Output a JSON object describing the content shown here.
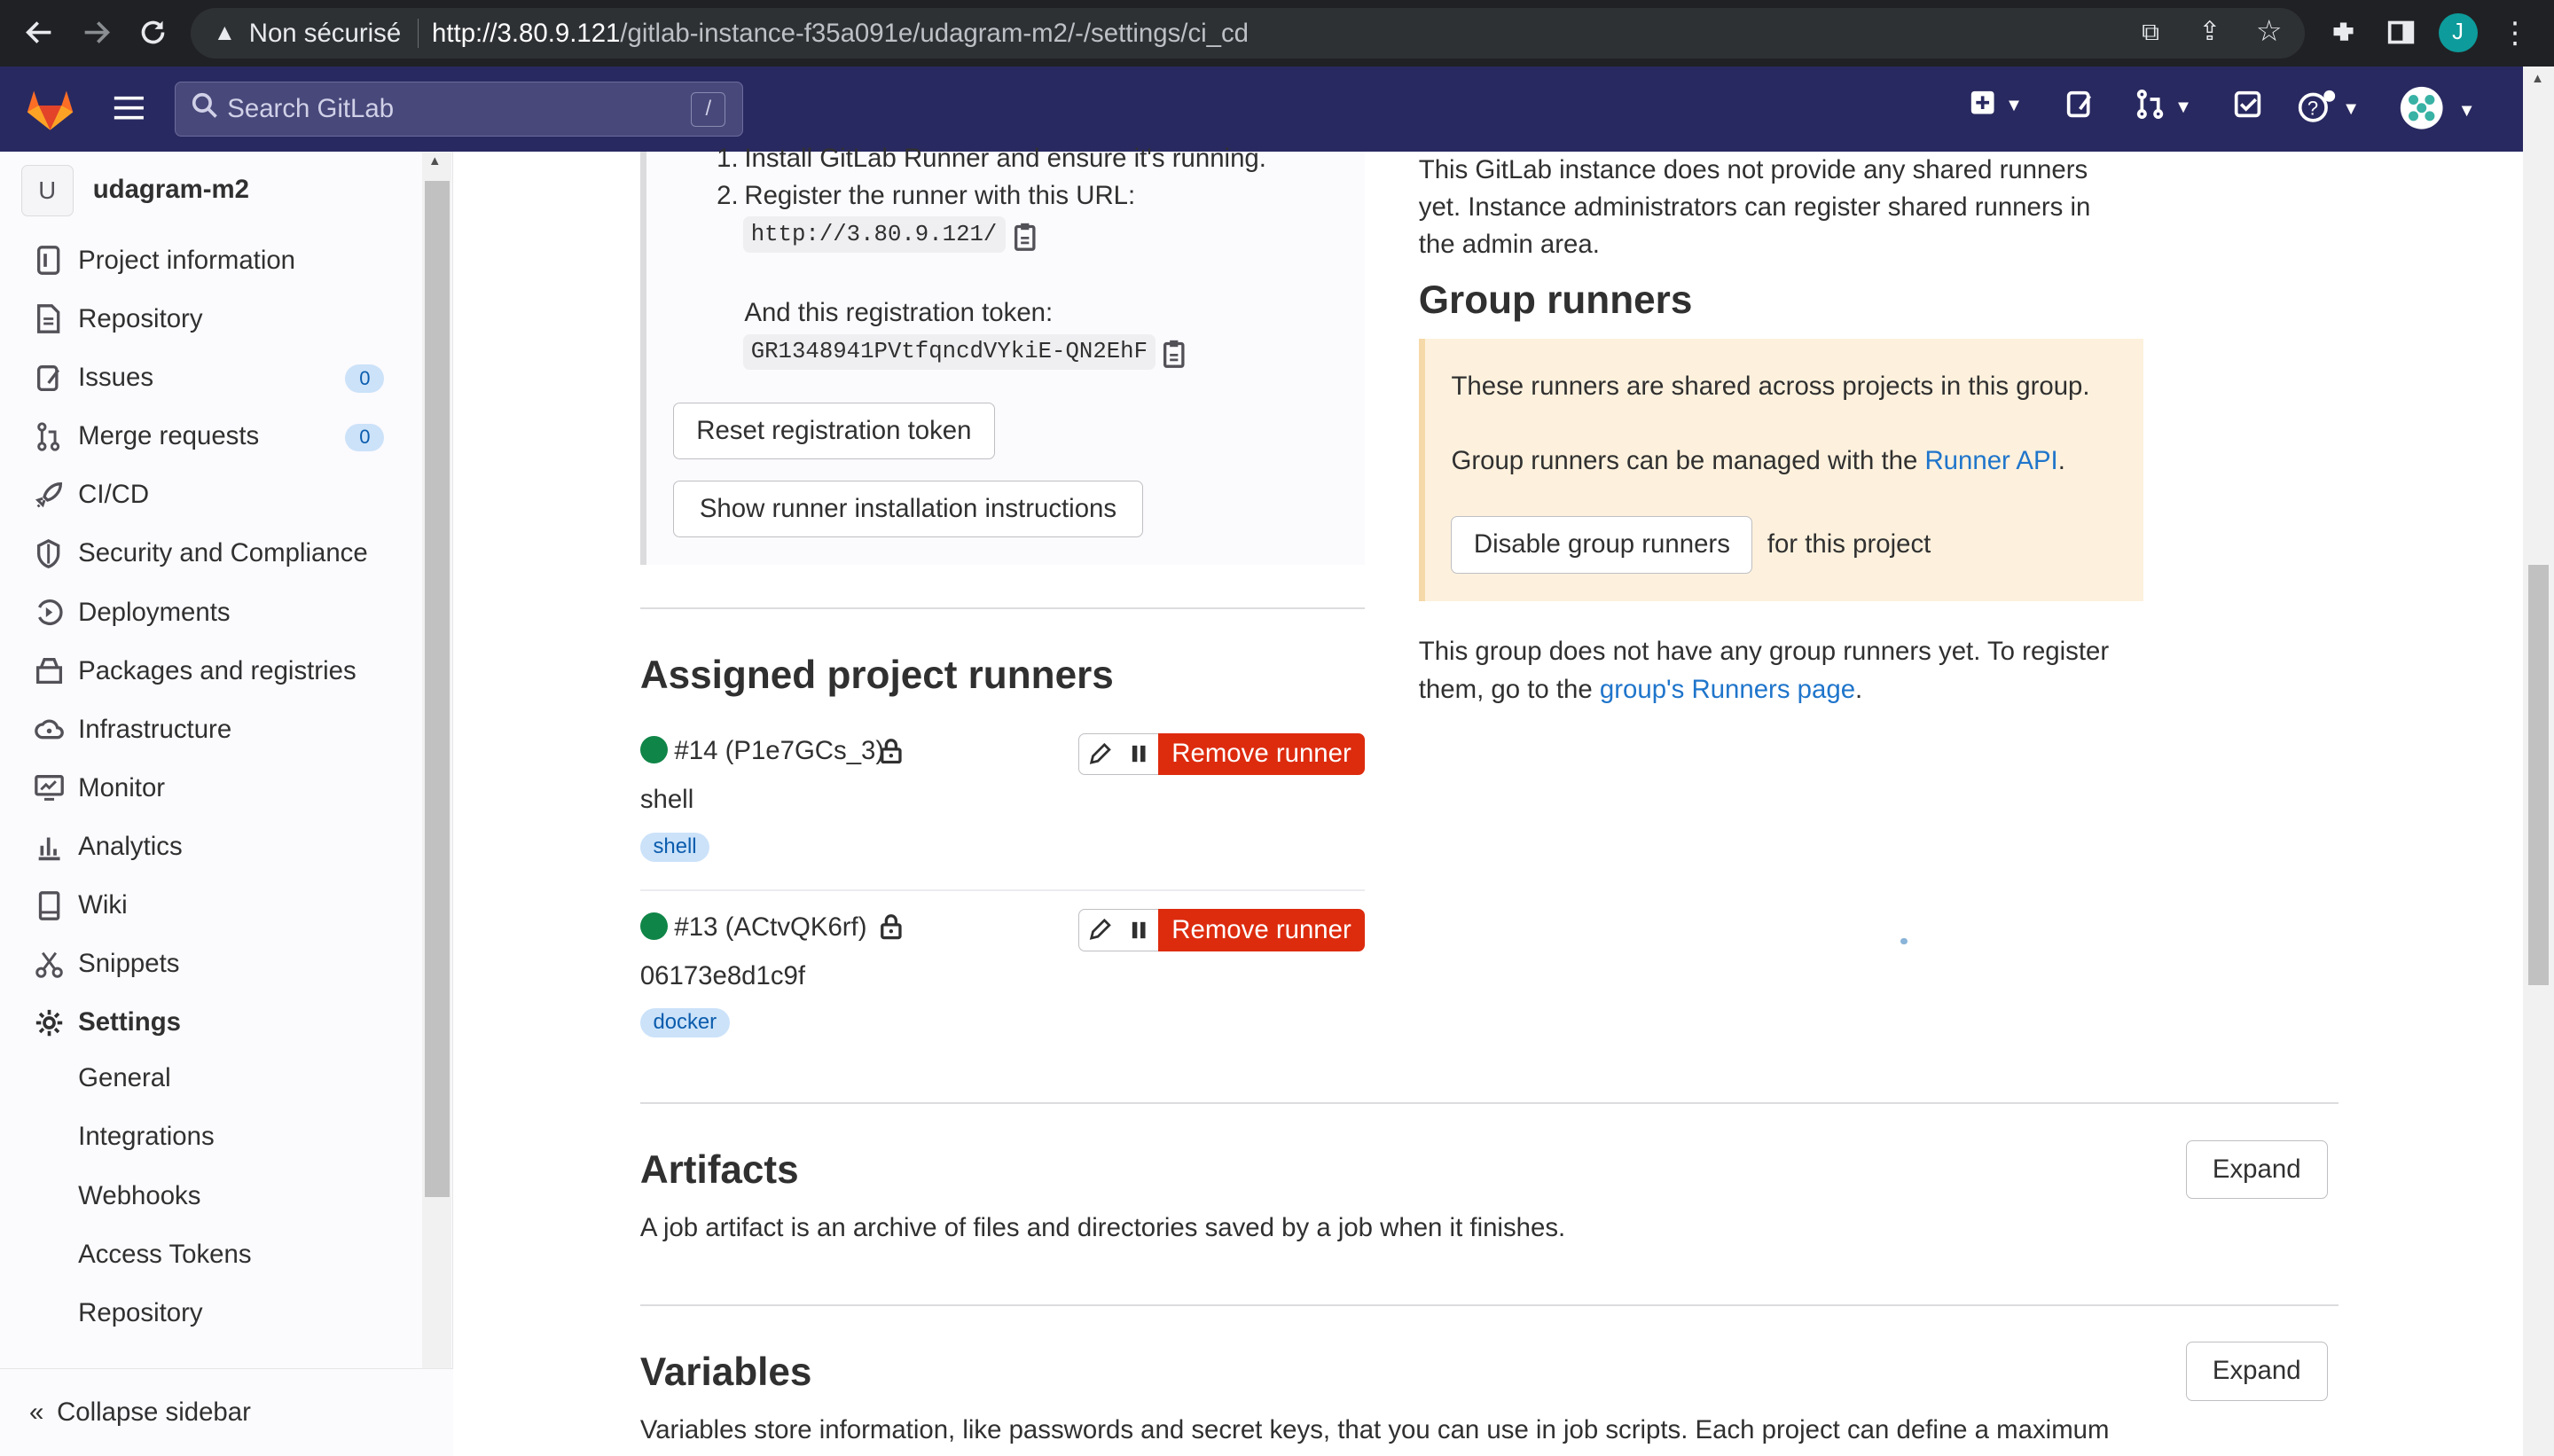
{
  "browser": {
    "security_label": "Non sécurisé",
    "url_host": "http://3.80.9.121",
    "url_path": "/gitlab-instance-f35a091e/udagram-m2/-/settings/ci_cd",
    "avatar_letter": "J"
  },
  "header": {
    "search_placeholder": "Search GitLab",
    "search_shortcut": "/"
  },
  "sidebar": {
    "project_letter": "U",
    "project_name": "udagram-m2",
    "items": [
      {
        "label": "Project information",
        "icon": "info-icon"
      },
      {
        "label": "Repository",
        "icon": "doc-icon"
      },
      {
        "label": "Issues",
        "icon": "issues-icon",
        "count": "0"
      },
      {
        "label": "Merge requests",
        "icon": "merge-icon",
        "count": "0"
      },
      {
        "label": "CI/CD",
        "icon": "rocket-icon"
      },
      {
        "label": "Security and Compliance",
        "icon": "shield-icon"
      },
      {
        "label": "Deployments",
        "icon": "deploy-icon"
      },
      {
        "label": "Packages and registries",
        "icon": "package-icon"
      },
      {
        "label": "Infrastructure",
        "icon": "cloud-icon"
      },
      {
        "label": "Monitor",
        "icon": "monitor-icon"
      },
      {
        "label": "Analytics",
        "icon": "chart-icon"
      },
      {
        "label": "Wiki",
        "icon": "book-icon"
      },
      {
        "label": "Snippets",
        "icon": "scissors-icon"
      },
      {
        "label": "Settings",
        "icon": "gear-icon"
      }
    ],
    "settings_subitems": [
      "General",
      "Integrations",
      "Webhooks",
      "Access Tokens",
      "Repository"
    ],
    "collapse_label": "Collapse sidebar"
  },
  "specific_runners": {
    "step1_link": "Install GitLab Runner and ensure it's running.",
    "step2_text": "Register the runner with this URL:",
    "runner_url": "http://3.80.9.121/",
    "token_text": "And this registration token:",
    "token": "GR1348941PVtfqncdVYkiE-QN2EhF",
    "reset_button": "Reset registration token",
    "show_instructions_button": "Show runner installation instructions"
  },
  "assigned": {
    "title": "Assigned project runners",
    "runners": [
      {
        "name": "#14 (P1e7GCs_3)",
        "description": "shell",
        "tag": "shell",
        "remove_label": "Remove runner"
      },
      {
        "name": "#13 (ACtvQK6rf)",
        "description": "06173e8d1c9f",
        "tag": "docker",
        "remove_label": "Remove runner"
      }
    ]
  },
  "shared": {
    "text_line1": "This GitLab instance does not provide any shared runners",
    "text_line2": "yet. Instance administrators can register shared runners in",
    "text_line3": "the admin area."
  },
  "group_runners": {
    "title": "Group runners",
    "alert_line1": "These runners are shared across projects in this group.",
    "alert_line2_pre": "Group runners can be managed with the",
    "alert_line2_link": "Runner API",
    "alert_line2_post": ".",
    "disable_button": "Disable group runners",
    "disable_suffix": "for this project",
    "none_line1": "This group does not have any group runners yet. To register",
    "none_line2_pre": "them, go to the",
    "none_line2_link": "group's Runners page",
    "none_line2_post": "."
  },
  "artifacts": {
    "title": "Artifacts",
    "description": "A job artifact is an archive of files and directories saved by a job when it finishes.",
    "expand": "Expand"
  },
  "variables": {
    "title": "Variables",
    "description": "Variables store information, like passwords and secret keys, that you can use in job scripts. Each project can define a maximum",
    "expand": "Expand"
  }
}
